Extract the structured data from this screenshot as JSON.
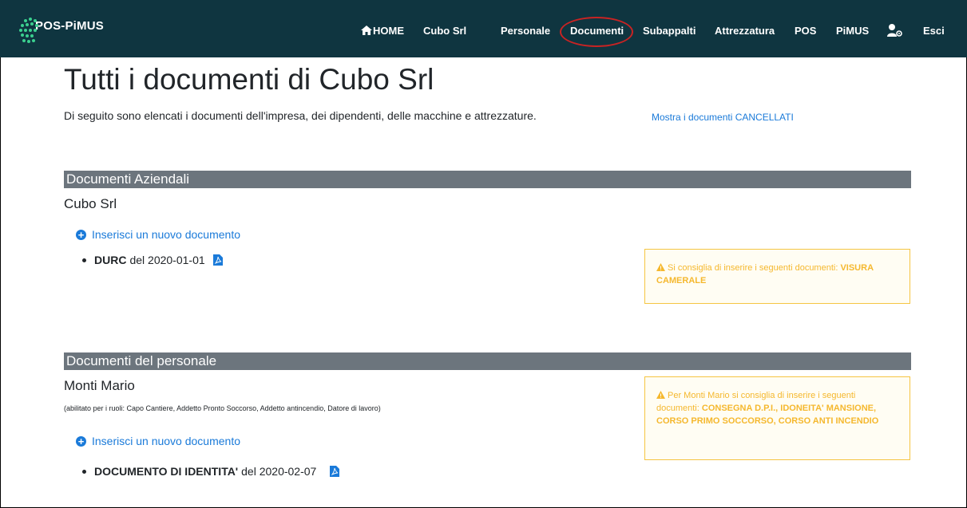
{
  "navbar": {
    "brand": "POS-PiMUS",
    "items": [
      {
        "label": "HOME",
        "icon": "home-icon"
      },
      {
        "label": "Cubo Srl"
      },
      {
        "label": "Personale"
      },
      {
        "label": "Documenti"
      },
      {
        "label": "Subappalti"
      },
      {
        "label": "Attrezzatura"
      },
      {
        "label": "POS"
      },
      {
        "label": "PiMUS"
      },
      {
        "label": "Esci"
      }
    ],
    "user_icon": "user-gear-icon",
    "brand_color": "#0f3540"
  },
  "page": {
    "title": "Tutti i documenti di Cubo Srl",
    "lead": "Di seguito sono elencati i documenti dell'impresa, dei dipendenti, delle macchine e attrezzature.",
    "show_deleted": "Mostra i documenti CANCELLATI"
  },
  "company_docs": {
    "section_title": "Documenti Aziendali",
    "company_name": "Cubo Srl",
    "add_label": "Inserisci un nuovo documento",
    "documents": [
      {
        "type": "DURC",
        "date_prefix": "del",
        "date": "2020-01-01"
      }
    ],
    "alert": {
      "text": "Si consiglia di inserire i seguenti documenti:",
      "items": "VISURA CAMERALE"
    }
  },
  "staff_docs": {
    "section_title": "Documenti del personale",
    "person_name": "Monti Mario",
    "roles": "(abilitato per i ruoli: Capo Cantiere, Addetto Pronto Soccorso, Addetto antincendio, Datore di lavoro)",
    "add_label": "Inserisci un nuovo documento",
    "documents": [
      {
        "type": "DOCUMENTO DI IDENTITA'",
        "date_prefix": "del",
        "date": "2020-02-07"
      }
    ],
    "alert": {
      "text": "Per Monti Mario si consiglia di inserire i seguenti documenti:",
      "items": "CONSEGNA D.P.I., IDONEITA' MANSIONE, CORSO PRIMO SOCCORSO, CORSO ANTI INCENDIO"
    }
  },
  "colors": {
    "link": "#1a7ad9",
    "section_bar": "#6c757d",
    "warning": "#f5b82e",
    "annotation": "#c92323"
  }
}
